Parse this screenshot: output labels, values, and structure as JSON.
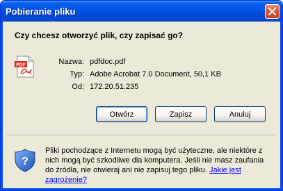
{
  "window": {
    "title": "Pobieranie pliku"
  },
  "dialog": {
    "question": "Czy chcesz otworzyć plik, czy zapisać go?",
    "fields": [
      {
        "label": "Nazwa:",
        "value": "pdfdoc.pdf"
      },
      {
        "label": "Typ:",
        "value": "Adobe Acrobat 7.0 Document, 50,1 KB"
      },
      {
        "label": "Od:",
        "value": "172.20.51.235"
      }
    ],
    "buttons": {
      "open": "Otwórz",
      "save": "Zapisz",
      "cancel": "Anuluj"
    },
    "warning": {
      "text": "Pliki pochodzące z Internetu mogą być użyteczne, ale niektóre z nich mogą być szkodliwe dla komputera. Jeśli nie masz zaufania do źródła, nie otwieraj ani nie zapisuj tego pliku.",
      "link": "Jakie jest zagrożenie?"
    }
  },
  "icons": {
    "file": "pdf-file-icon",
    "security": "security-shield-icon",
    "close": "close-icon"
  },
  "colors": {
    "titlebar": "#0055e5",
    "dialog_bg": "#ece9d8",
    "close_button": "#d9573b",
    "link": "#0000ff"
  }
}
